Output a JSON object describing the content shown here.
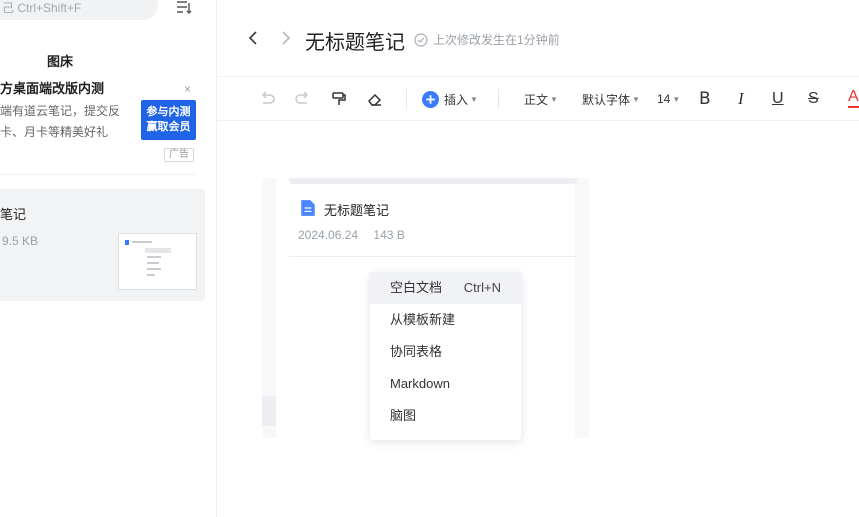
{
  "sidebar": {
    "search_placeholder": "己 Ctrl+Shift+F",
    "section_title": "图床",
    "ad": {
      "title": "方桌面端改版内测",
      "desc_line1": "端有道云笔记，提交反",
      "desc_line2": "卡、月卡等精美好礼",
      "image_text_line1": "参与内测",
      "image_text_line2": "赢取会员",
      "badge": "广告",
      "close": "×"
    },
    "note": {
      "title": "笔记",
      "size": "9.5 KB"
    }
  },
  "header": {
    "title": "无标题笔记",
    "save_status": "上次修改发生在1分钟前"
  },
  "toolbar": {
    "insert_label": "插入",
    "paragraph_style": "正文",
    "font_family": "默认字体",
    "font_size": "14",
    "bold": "B",
    "italic": "I",
    "underline": "U",
    "strike": "S",
    "font_color": "A",
    "accent_color": "#3b7cff",
    "font_color_value": "#e33"
  },
  "panel": {
    "file_name": "无标题笔记",
    "file_date": "2024.06.24",
    "file_size": "143 B"
  },
  "context_menu": {
    "items": [
      {
        "label": "空白文档",
        "shortcut": "Ctrl+N"
      },
      {
        "label": "从模板新建"
      },
      {
        "label": "协同表格"
      },
      {
        "label": "Markdown"
      },
      {
        "label": "脑图"
      }
    ]
  }
}
